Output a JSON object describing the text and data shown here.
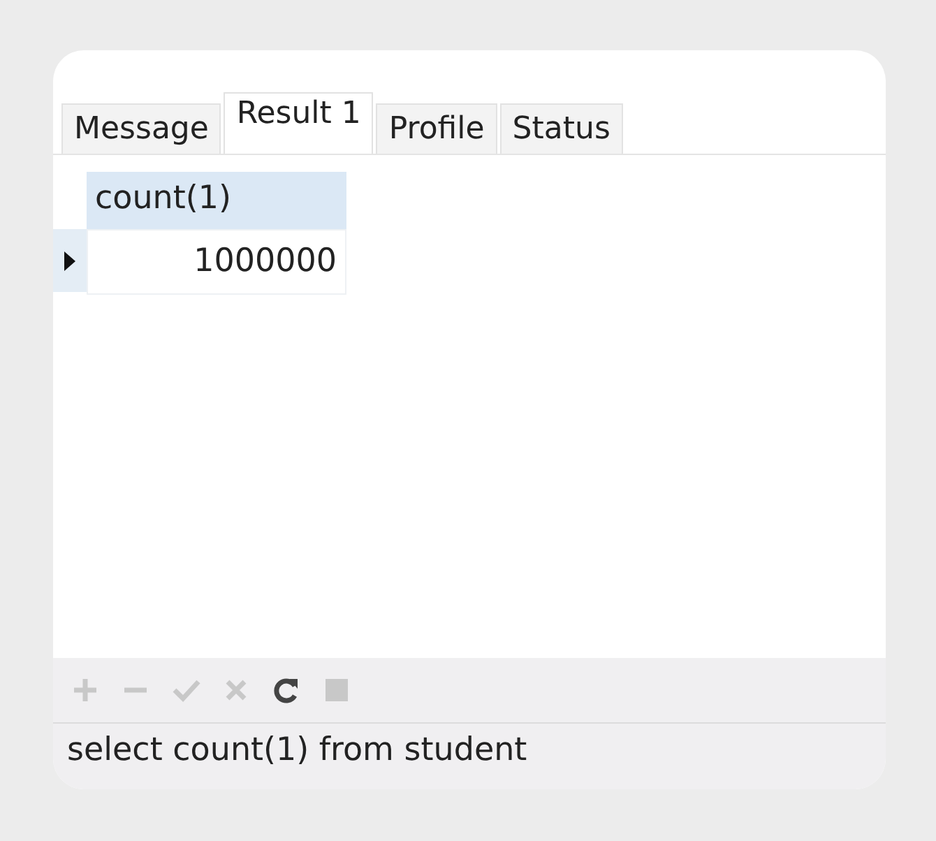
{
  "tabs": [
    {
      "label": "Message",
      "selected": false
    },
    {
      "label": "Result 1",
      "selected": true
    },
    {
      "label": "Profile",
      "selected": false
    },
    {
      "label": "Status",
      "selected": false
    }
  ],
  "table": {
    "columns": [
      "count(1)"
    ],
    "rows": [
      {
        "cells": [
          "1000000"
        ],
        "selected": true
      }
    ]
  },
  "toolbar": [
    {
      "kind": "add",
      "disabled": true
    },
    {
      "kind": "remove",
      "disabled": true
    },
    {
      "kind": "apply",
      "disabled": true
    },
    {
      "kind": "discard",
      "disabled": true
    },
    {
      "kind": "refresh",
      "disabled": false
    },
    {
      "kind": "stop",
      "disabled": true
    }
  ],
  "status_bar": {
    "query": "select count(1) from student"
  }
}
